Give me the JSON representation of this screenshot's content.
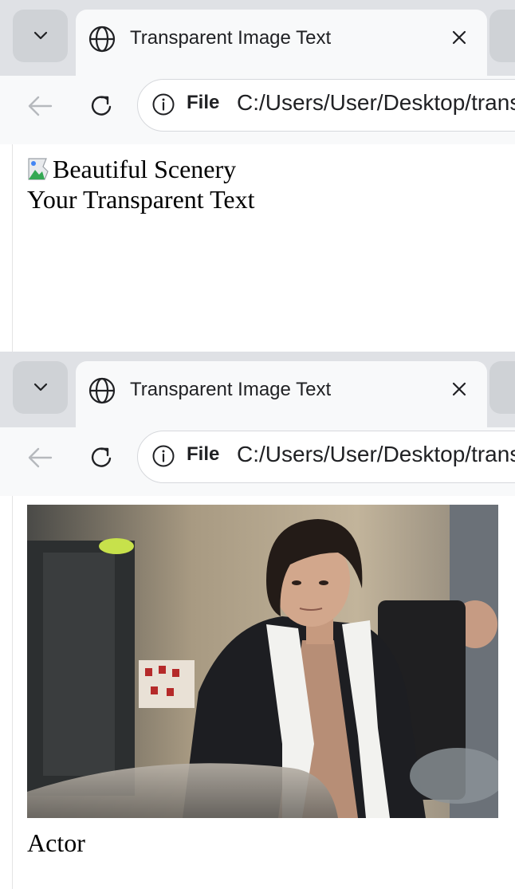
{
  "browser": {
    "tab_title": "Transparent Image Text",
    "address_scheme_label": "File",
    "url": "C:/Users/User/Desktop/transparent.html"
  },
  "screenshots": [
    {
      "image_alt_text": "Beautiful Scenery",
      "caption": "Your Transparent Text",
      "image_loaded": false
    },
    {
      "photo_subject": "man with long dark hair in dark suit and white scarf",
      "caption": "Actor",
      "image_loaded": true
    }
  ],
  "colors": {
    "tabstrip": "#dfe1e5",
    "active_tab": "#f8f9fa",
    "page_background": "#ffffff",
    "text": "#000000"
  }
}
